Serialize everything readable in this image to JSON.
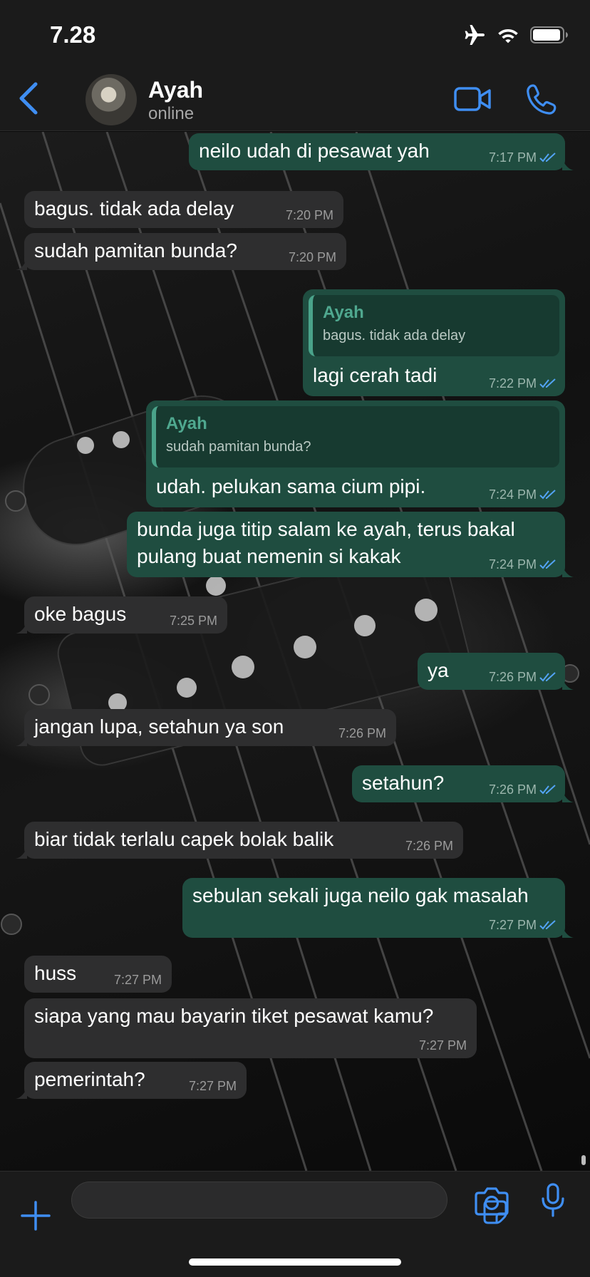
{
  "status_bar": {
    "time": "7.28",
    "icons": [
      "airplane-icon",
      "wifi-icon",
      "battery-icon"
    ]
  },
  "header": {
    "back_icon": "chevron-left-icon",
    "contact_name": "Ayah",
    "contact_status": "online",
    "actions": [
      "video-call-icon",
      "phone-call-icon"
    ]
  },
  "colors": {
    "accent": "#3f8ef2",
    "incoming_bubble": "#2e2e2f",
    "outgoing_bubble": "#1f4d40",
    "quote_bar": "#4aa38a",
    "read_ticks": "#53a3f5"
  },
  "messages": [
    {
      "dir": "out",
      "text": "neilo udah di pesawat yah",
      "time": "7:17 PM",
      "read": true
    },
    {
      "dir": "in",
      "text": "bagus. tidak ada delay",
      "time": "7:20 PM"
    },
    {
      "dir": "in",
      "text": "sudah pamitan bunda?",
      "time": "7:20 PM"
    },
    {
      "dir": "out",
      "text": "lagi cerah tadi",
      "time": "7:22 PM",
      "read": true,
      "quote": {
        "author": "Ayah",
        "text": "bagus. tidak ada delay"
      }
    },
    {
      "dir": "out",
      "text": "udah. pelukan sama cium pipi.",
      "time": "7:24 PM",
      "read": true,
      "quote": {
        "author": "Ayah",
        "text": "sudah pamitan bunda?"
      }
    },
    {
      "dir": "out",
      "lines": [
        "bunda juga titip salam ke ayah, terus bakal",
        "pulang buat nemenin si kakak"
      ],
      "time": "7:24 PM",
      "read": true
    },
    {
      "dir": "in",
      "text": "oke bagus",
      "time": "7:25 PM"
    },
    {
      "dir": "out",
      "text": "ya",
      "time": "7:26 PM",
      "read": true
    },
    {
      "dir": "in",
      "text": "jangan lupa, setahun ya son",
      "time": "7:26 PM"
    },
    {
      "dir": "out",
      "text": "setahun?",
      "time": "7:26 PM",
      "read": true
    },
    {
      "dir": "in",
      "text": "biar tidak terlalu capek bolak balik",
      "time": "7:26 PM"
    },
    {
      "dir": "out",
      "text": "sebulan sekali juga neilo gak masalah",
      "time": "7:27 PM",
      "read": true
    },
    {
      "dir": "in",
      "text": "huss",
      "time": "7:27 PM"
    },
    {
      "dir": "in",
      "text": "siapa yang mau bayarin tiket pesawat kamu?",
      "time": "7:27 PM"
    },
    {
      "dir": "in",
      "text": "pemerintah?",
      "time": "7:27 PM"
    }
  ],
  "composer": {
    "input_value": "",
    "icons": [
      "plus-icon",
      "sticker-icon",
      "camera-icon",
      "microphone-icon"
    ]
  }
}
